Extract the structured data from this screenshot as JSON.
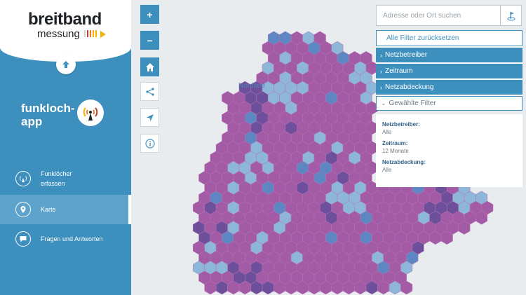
{
  "logo": {
    "main": "breitband",
    "sub": "messung",
    "bar_colors": [
      "#d3d3d3",
      "#c0392b",
      "#e67e22",
      "#f2b400",
      "#f2b400"
    ]
  },
  "sidebar": {
    "app_title_line1": "funkloch-",
    "app_title_line2": "app",
    "nav": [
      {
        "label_line1": "Funklöcher",
        "label_line2": "erfassen",
        "icon": "signal-icon"
      },
      {
        "label_line1": "Karte",
        "label_line2": "",
        "icon": "map-pin-icon"
      },
      {
        "label_line1": "Fragen und Antworten",
        "label_line2": "",
        "icon": "chat-icon"
      }
    ]
  },
  "map": {
    "city_labels": [
      "Nordsee"
    ],
    "colors": {
      "hex_fill": "#a45ba6",
      "hex_stroke": "#b773b6",
      "light_blue": "#8db6d9",
      "mid_blue": "#5d86c2",
      "dark_purple": "#6e4f9c"
    }
  },
  "controls": {
    "zoom_in": "+",
    "zoom_out": "−"
  },
  "search": {
    "placeholder": "Adresse oder Ort suchen"
  },
  "filters": {
    "reset": "Alle Filter zurücksetzen",
    "items": [
      "Netzbetreiber",
      "Zeitraum",
      "Netzabdeckung"
    ],
    "selected": "Gewählte Filter"
  },
  "selected_filters": [
    {
      "label": "Netzbetreiber:",
      "value": "Alle"
    },
    {
      "label": "Zeitraum:",
      "value": "12 Monate"
    },
    {
      "label": "Netzabdeckung:",
      "value": "Alle"
    }
  ],
  "theme": {
    "accent": "#3d8fbd",
    "accent_light": "#5ea3cb"
  }
}
